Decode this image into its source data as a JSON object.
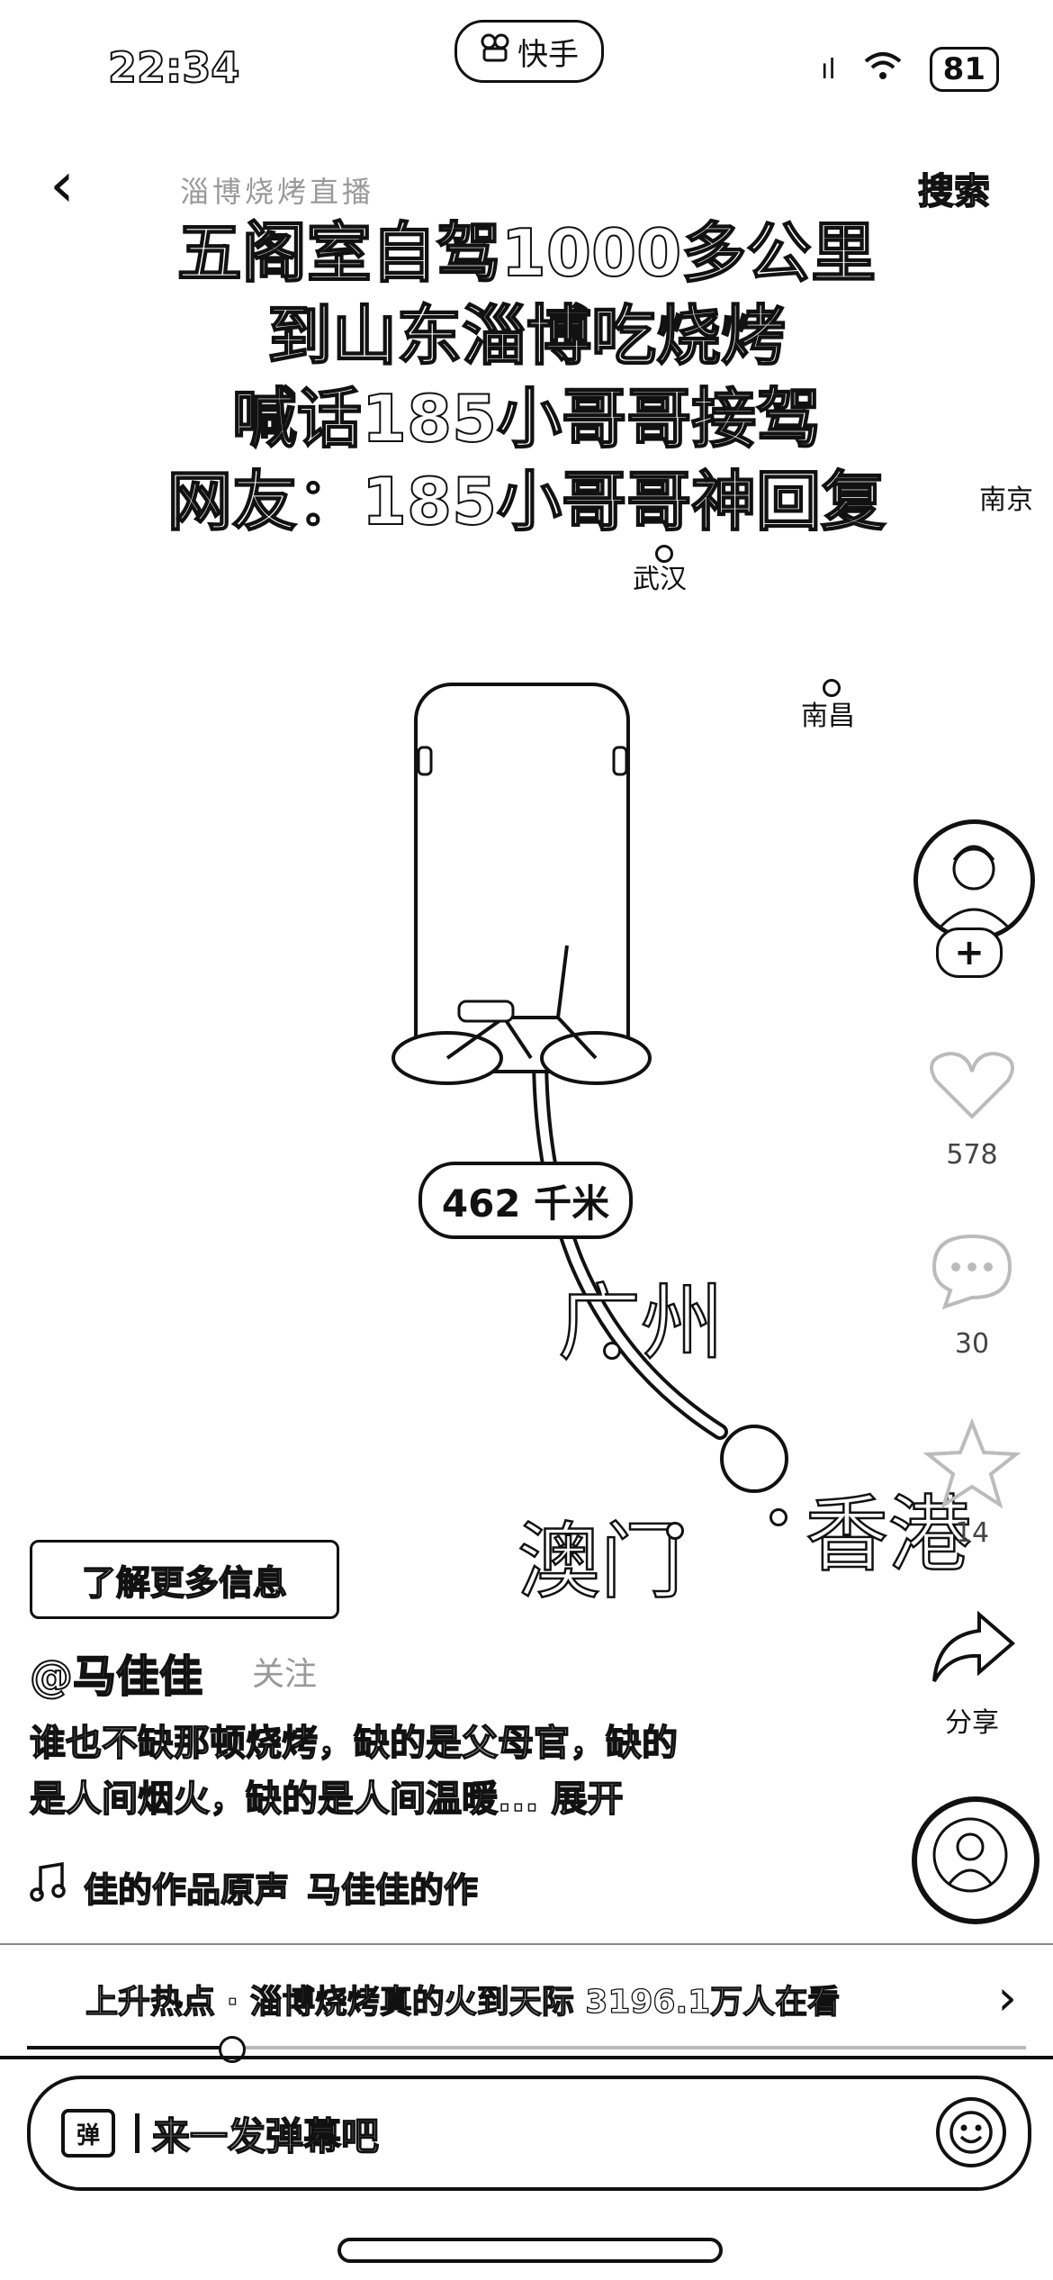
{
  "status": {
    "time": "22:34",
    "signal": "ıl",
    "battery": "81"
  },
  "app": {
    "name": "快手"
  },
  "nav": {
    "back_glyph": "‹",
    "search_hint": "淄博烧烤直播",
    "search_label": "搜索"
  },
  "headline": {
    "lines": [
      "五阁室自驾1000多公里",
      "到山东淄博吃烧烤",
      "喊话185小哥哥接驾",
      "网友：185小哥哥神回复"
    ]
  },
  "map": {
    "cities_small": [
      "武汉",
      "南昌",
      "南京"
    ],
    "cities_big": [
      "广州",
      "澳门",
      "香港"
    ],
    "distance": "462 千米"
  },
  "side": {
    "like_count": "578",
    "comment_count": "30",
    "fav_count": "14",
    "share_label": "分享",
    "follow_glyph": "+"
  },
  "post": {
    "learn_more": "了解更多信息",
    "author": "@马佳佳",
    "author_tag": "关注",
    "desc_line1": "谁也不缺那顿烧烤，缺的是父母官，缺的",
    "desc_line2": "是人间烟火，缺的是人间温暖... 展开",
    "music_a": "佳的作品原声",
    "music_b": "马佳佳的作"
  },
  "hot": {
    "text": "上升热点 · 淄博烧烤真的火到天际  3196.1万人在看",
    "chevron": "›"
  },
  "progress": {
    "fraction": 0.2
  },
  "comment": {
    "danmu_label": "弹",
    "placeholder": "来一发弹幕吧"
  }
}
